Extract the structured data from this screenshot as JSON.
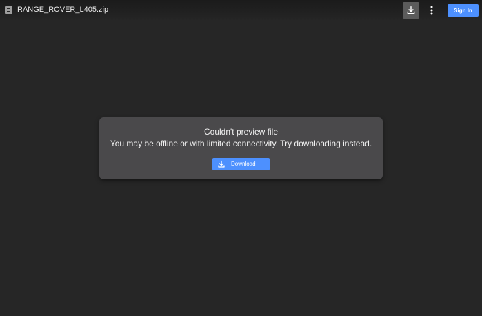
{
  "header": {
    "file_name": "RANGE_ROVER_L405.zip",
    "sign_in_label": "Sign In",
    "file_icon": "document-icon",
    "download_icon": "download-icon",
    "more_icon": "more-vertical-icon"
  },
  "dialog": {
    "title": "Couldn't preview file",
    "message": "You may be offline or with limited connectivity. Try downloading instead.",
    "download_label": "Download",
    "download_icon": "download-icon"
  },
  "colors": {
    "background": "#262626",
    "dialog_background": "#4a494b",
    "accent": "#4d90fe",
    "top_download_background": "#5b5b5b"
  }
}
